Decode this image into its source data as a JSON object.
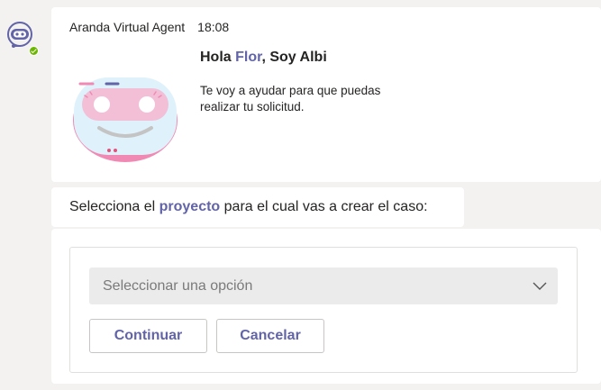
{
  "message": {
    "sender": "Aranda Virtual Agent",
    "time": "18:08",
    "greeting": {
      "prefix": "Hola ",
      "name": "Flor",
      "suffix": ", Soy Albi"
    },
    "subtitle": "Te voy a ayudar para que puedas realizar tu solicitud."
  },
  "prompt": {
    "prefix": "Selecciona el ",
    "highlight": "proyecto",
    "suffix": " para el cual vas a crear el caso:"
  },
  "form": {
    "select_placeholder": "Seleccionar una opción",
    "continue_label": "Continuar",
    "cancel_label": "Cancelar"
  },
  "colors": {
    "accent": "#6264a7",
    "status": "#6bb700",
    "robot_pink": "#f08ab5",
    "robot_face": "#dff1fb"
  },
  "icons": {
    "avatar": "robot-bot-icon",
    "status": "available-check-icon",
    "dropdown": "chevron-down-icon"
  }
}
